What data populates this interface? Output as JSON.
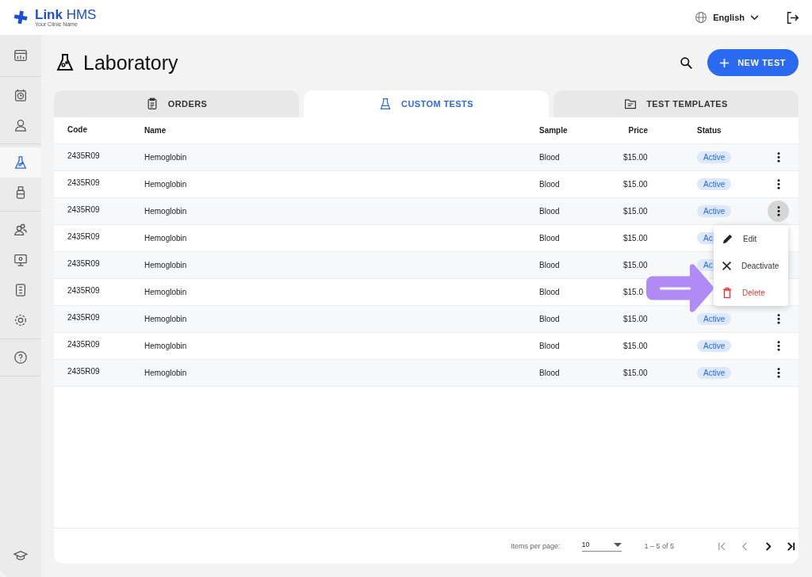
{
  "brand": {
    "name": "**Link** HMS",
    "tagline": "Your Clinic Name"
  },
  "language": "English",
  "sidebar": {
    "groups": [
      {
        "items": [
          {
            "selected": false
          }
        ]
      },
      {
        "items": [
          {
            "selected": false
          },
          {
            "selected": false
          }
        ]
      },
      {
        "items": [
          {
            "selected": true
          },
          {
            "selected": false
          }
        ]
      },
      {
        "items": [
          {
            "selected": false
          },
          {
            "selected": false
          },
          {
            "selected": false
          },
          {
            "selected": false
          }
        ]
      },
      {
        "items": [
          {
            "selected": false
          }
        ]
      }
    ],
    "bottom_item": {
      "selected": false
    }
  },
  "page_title": "Laboratory",
  "new_button": "NEW TEST",
  "tabs": [
    {
      "label": "ORDERS",
      "selected": false
    },
    {
      "label": "CUSTOM TESTS",
      "selected": true
    },
    {
      "label": "TEST TEMPLATES",
      "selected": false
    }
  ],
  "table": {
    "columns": [
      "Code",
      "Name",
      "Sample",
      "Price",
      "Status"
    ],
    "rows": [
      {
        "code": "2435R09",
        "name": "Hemoglobin",
        "sample": "Blood",
        "price": "$15.00",
        "status": "Active",
        "menu_open": false
      },
      {
        "code": "2435R09",
        "name": "Hemoglobin",
        "sample": "Blood",
        "price": "$15.00",
        "status": "Active",
        "menu_open": false
      },
      {
        "code": "2435R09",
        "name": "Hemoglobin",
        "sample": "Blood",
        "price": "$15.00",
        "status": "Active",
        "menu_open": true
      },
      {
        "code": "2435R09",
        "name": "Hemoglobin",
        "sample": "Blood",
        "price": "$15.00",
        "status": "Ac"
      },
      {
        "code": "2435R09",
        "name": "Hemoglobin",
        "sample": "Blood",
        "price": "$15.00",
        "status": "Ac"
      },
      {
        "code": "2435R09",
        "name": "Hemoglobin",
        "sample": "Blood",
        "price": "$15.0"
      },
      {
        "code": "2435R09",
        "name": "Hemoglobin",
        "sample": "Blood",
        "price": "$15.00",
        "status": "Active",
        "menu_open": false
      },
      {
        "code": "2435R09",
        "name": "Hemoglobin",
        "sample": "Blood",
        "price": "$15.00",
        "status": "Active",
        "menu_open": false
      },
      {
        "code": "2435R09",
        "name": "Hemoglobin",
        "sample": "Blood",
        "price": "$15.00",
        "status": "Active",
        "menu_open": false
      }
    ]
  },
  "row_menu": [
    {
      "label": "Edit",
      "kind": "edit"
    },
    {
      "label": "Deactivate",
      "kind": "deactivate"
    },
    {
      "label": "Delete",
      "kind": "delete"
    }
  ],
  "pagination": {
    "label": "Items per page:",
    "per_page": "10",
    "range": "1 – 5 of 5",
    "buttons": [
      {
        "kind": "first",
        "disabled": true
      },
      {
        "kind": "prev",
        "disabled": true
      },
      {
        "kind": "next",
        "disabled": false
      },
      {
        "kind": "last",
        "disabled": false
      }
    ]
  }
}
